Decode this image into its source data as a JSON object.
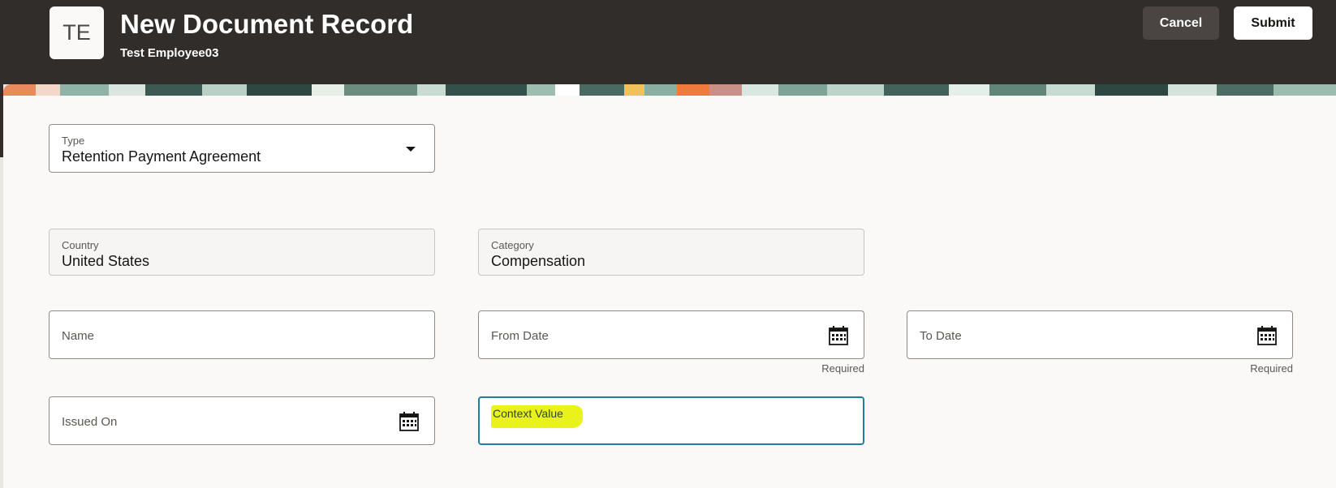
{
  "header": {
    "avatar_initials": "TE",
    "title": "New Document Record",
    "subtitle": "Test Employee03",
    "cancel_label": "Cancel",
    "submit_label": "Submit",
    "background_color": "#312d2a"
  },
  "form": {
    "type": {
      "label": "Type",
      "value": "Retention Payment Agreement"
    },
    "country": {
      "label": "Country",
      "value": "United States"
    },
    "category": {
      "label": "Category",
      "value": "Compensation"
    },
    "name": {
      "placeholder": "Name"
    },
    "from_date": {
      "placeholder": "From Date",
      "helper": "Required"
    },
    "to_date": {
      "placeholder": "To Date",
      "helper": "Required"
    },
    "issued_on": {
      "placeholder": "Issued On"
    },
    "context_value": {
      "label": "Context Value"
    }
  },
  "colors": {
    "focus_border": "#227e9e",
    "highlight": "#e9f21a"
  },
  "icons": {
    "calendar": "calendar-icon",
    "dropdown": "chevron-down-icon"
  }
}
